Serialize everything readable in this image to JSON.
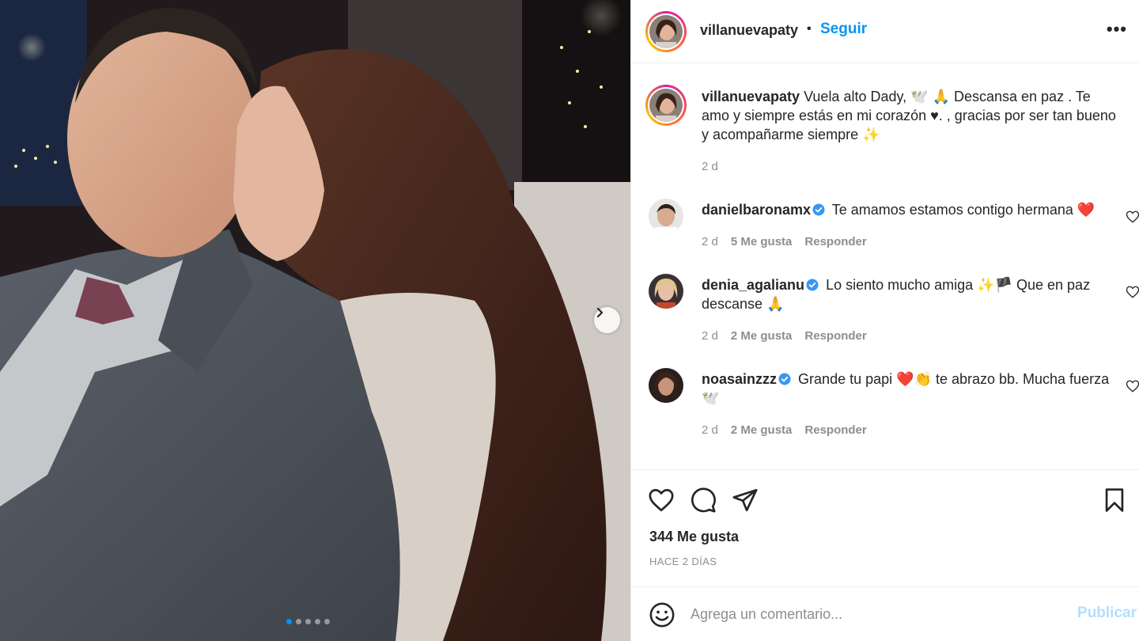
{
  "post": {
    "username": "villanuevapaty",
    "follow_label": "Seguir",
    "separator": "•",
    "more_label": "•••",
    "caption": {
      "username": "villanuevapaty",
      "text": "Vuela alto Dady, 🕊️ 🙏 Descansa en paz . Te amo y siempre estás en mi corazón ♥. , gracias por ser tan bueno y acompañarme siempre ✨",
      "time": "2 d"
    },
    "comments": [
      {
        "username": "danielbaronamx",
        "verified": true,
        "text": "Te amamos estamos contigo hermana ❤️",
        "time": "2 d",
        "likes": "5 Me gusta",
        "reply": "Responder"
      },
      {
        "username": "denia_agalianu",
        "verified": true,
        "text": "Lo siento mucho amiga ✨🏴 Que en paz descanse 🙏",
        "time": "2 d",
        "likes": "2 Me gusta",
        "reply": "Responder"
      },
      {
        "username": "noasainzzz",
        "verified": true,
        "text": "Grande tu papi ❤️👏 te abrazo bb. Mucha fuerza 🕊️",
        "time": "2 d",
        "likes": "2 Me gusta",
        "reply": "Responder"
      }
    ],
    "likes_count": "344 Me gusta",
    "posted_ago": "HACE 2 DÍAS",
    "comment_placeholder": "Agrega un comentario...",
    "publish_label": "Publicar",
    "carousel": {
      "total": 5,
      "active": 1
    }
  },
  "colors": {
    "accent": "#0095f6",
    "publish_disabled": "#b2dffc",
    "verified": "#3897f0",
    "text": "#262626",
    "secondary": "#8e8e8e"
  },
  "icons": [
    "like-icon",
    "comment-icon",
    "share-icon",
    "save-icon",
    "emoji-icon",
    "more-icon",
    "next-arrow-icon",
    "heart-icon",
    "verified-badge-icon"
  ]
}
